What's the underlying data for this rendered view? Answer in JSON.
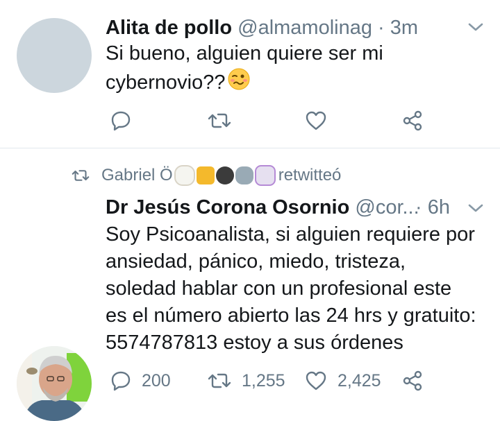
{
  "tweet1": {
    "name": "Alita de pollo",
    "handle": "@almamolinag",
    "separator": "·",
    "time": "3m",
    "text_line1": "Si bueno, alguien quiere ser mi",
    "text_line2": "cybernovio??",
    "emoji_icon": "woozy-face-icon",
    "actions": {
      "reply_icon": "reply-icon",
      "retweet_icon": "retweet-icon",
      "like_icon": "heart-icon",
      "share_icon": "share-icon"
    }
  },
  "tweet2": {
    "retweet_context": {
      "icon": "retweet-icon",
      "user": "Gabriel Ö",
      "emojis": [
        "sheep-icon",
        "giraffe-icon",
        "gorilla-icon",
        "elephant-icon",
        "unicorn-icon"
      ],
      "label": "retwitteó"
    },
    "name": "Dr Jesús Corona Osornio",
    "handle": "@cor...",
    "separator": "·",
    "time": "6h",
    "text_lines": [
      "Soy Psicoanalista, si alguien requiere por",
      "ansiedad, pánico, miedo, tristeza,",
      "soledad hablar con un profesional este",
      "es el número abierto las 24 hrs y gratuito:",
      "5574787813 estoy a sus órdenes"
    ],
    "counts": {
      "replies": "200",
      "retweets": "1,255",
      "likes": "2,425"
    }
  },
  "colors": {
    "text": "#14171a",
    "secondary": "#657786",
    "divider": "#e1e8ed",
    "avatar_placeholder": "#ccd6dd"
  }
}
